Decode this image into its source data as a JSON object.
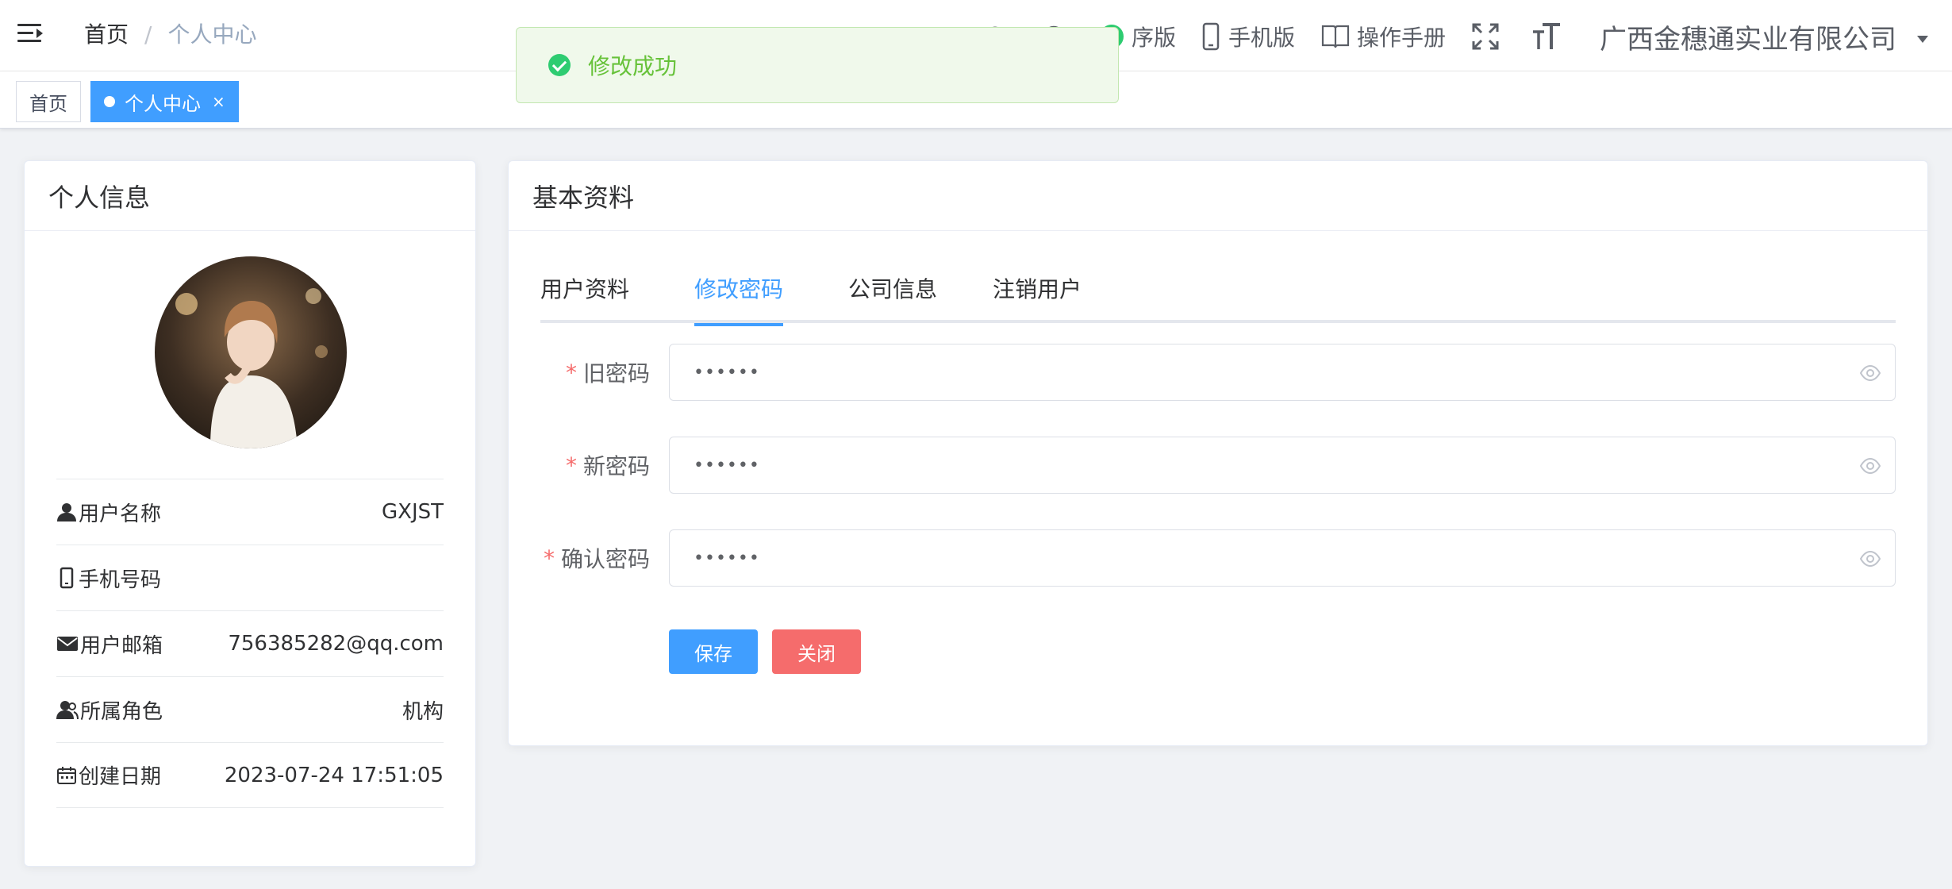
{
  "navbar": {
    "breadcrumb": {
      "home": "首页",
      "separator": "/",
      "current": "个人中心"
    },
    "right_menu": [
      {
        "label": "手机版",
        "icon": "mobile-icon"
      },
      {
        "label": "操作手册",
        "icon": "book-icon"
      }
    ],
    "partial_items": {
      "mini_program": "序版"
    },
    "company": "广西金穗通实业有限公司"
  },
  "tagsview": {
    "home": "首页",
    "active": "个人中心",
    "close": "×"
  },
  "toast": {
    "message": "修改成功"
  },
  "left_card": {
    "title": "个人信息",
    "rows": [
      {
        "label": "用户名称",
        "value": "GXJST",
        "icon": "user-icon"
      },
      {
        "label": "手机号码",
        "value": "",
        "icon": "phone-icon"
      },
      {
        "label": "用户邮箱",
        "value": "756385282@qq.com",
        "icon": "email-icon"
      },
      {
        "label": "所属角色",
        "value": "机构",
        "icon": "role-icon"
      },
      {
        "label": "创建日期",
        "value": "2023-07-24 17:51:05",
        "icon": "calendar-icon"
      }
    ]
  },
  "right_card": {
    "title": "基本资料",
    "tabs": [
      "用户资料",
      "修改密码",
      "公司信息",
      "注销用户"
    ],
    "active_tab": "修改密码",
    "form": {
      "required_mark": "*",
      "old_password": {
        "label": "旧密码",
        "value": "••••••"
      },
      "new_password": {
        "label": "新密码",
        "value": "••••••"
      },
      "confirm_password": {
        "label": "确认密码",
        "value": "••••••"
      }
    },
    "buttons": {
      "save": "保存",
      "close": "关闭"
    }
  },
  "colors": {
    "primary": "#409eff",
    "danger": "#f56c6c",
    "success": "#67c23a"
  }
}
